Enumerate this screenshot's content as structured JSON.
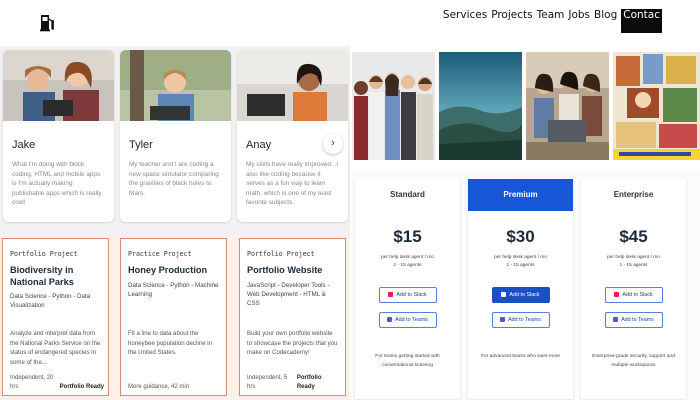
{
  "nav": {
    "items": [
      "Services",
      "Projects",
      "Team",
      "Jobs",
      "Blog",
      "Contact"
    ],
    "active_label": "Contac"
  },
  "testimonials": [
    {
      "name": "Jake",
      "quote": "What I'm doing with block coding, HTML and mobile apps is I'm actually making publishable apps which is really cool!"
    },
    {
      "name": "Tyler",
      "quote": "My teacher and I are coding a new space simulator comparing the gravities of black holes to Mars."
    },
    {
      "name": "Anay",
      "quote": "My skills have really improved...I also like coding because it serves as a fun way to learn math, which is one of my least favorite subjects."
    }
  ],
  "projects": [
    {
      "type": "Portfolio Project",
      "title": "Biodiversity in National Parks",
      "tags": "Data Science - Python - Data Visualization",
      "desc": "Analyze and interpret data from the National Parks Service on the status of endangered species in some of the...",
      "footer": "Independent, 20 hrs",
      "badge": "Portfolio Ready"
    },
    {
      "type": "Practice Project",
      "title": "Honey Production",
      "tags": "Data Science - Python - Machine Learning",
      "desc": "Fit a line to data about the honeybee population decline in the United States.",
      "footer": "More guidance, 42 min",
      "badge": ""
    },
    {
      "type": "Portfolio Project",
      "title": "Portfolio Website",
      "tags": "JavaScript - Developer Tools - Web Development - HTML & CSS",
      "desc": "Build your own portfolio website to showcase the projects that you make on Codecademy!",
      "footer": "Independent, 5 hrs",
      "badge": "Portfolio Ready"
    }
  ],
  "pricing": [
    {
      "name": "Standard",
      "price": "$15",
      "per": "per help desk agent / mo",
      "agents": "1 - 15 agents",
      "slack": "Add to Slack",
      "teams": "Add to Teams",
      "desc": "For teams getting started with conversational ticketing"
    },
    {
      "name": "Premium",
      "price": "$30",
      "per": "per help desk agent / mo",
      "agents": "1 - 15 agents",
      "slack": "Add to Slack",
      "teams": "Add to Teams",
      "desc": "For advanced teams who want more"
    },
    {
      "name": "Enterprise",
      "price": "$45",
      "per": "per help desk agent / mo",
      "agents": "1 - 15 agents",
      "slack": "Add to Slack",
      "teams": "Add to Teams",
      "desc": "Enterprise-grade security, support and multiple workspaces"
    }
  ],
  "colors": {
    "premium": "#1756d6",
    "card_border": "#d48b7a",
    "project_bg": "#fdf0e8"
  }
}
